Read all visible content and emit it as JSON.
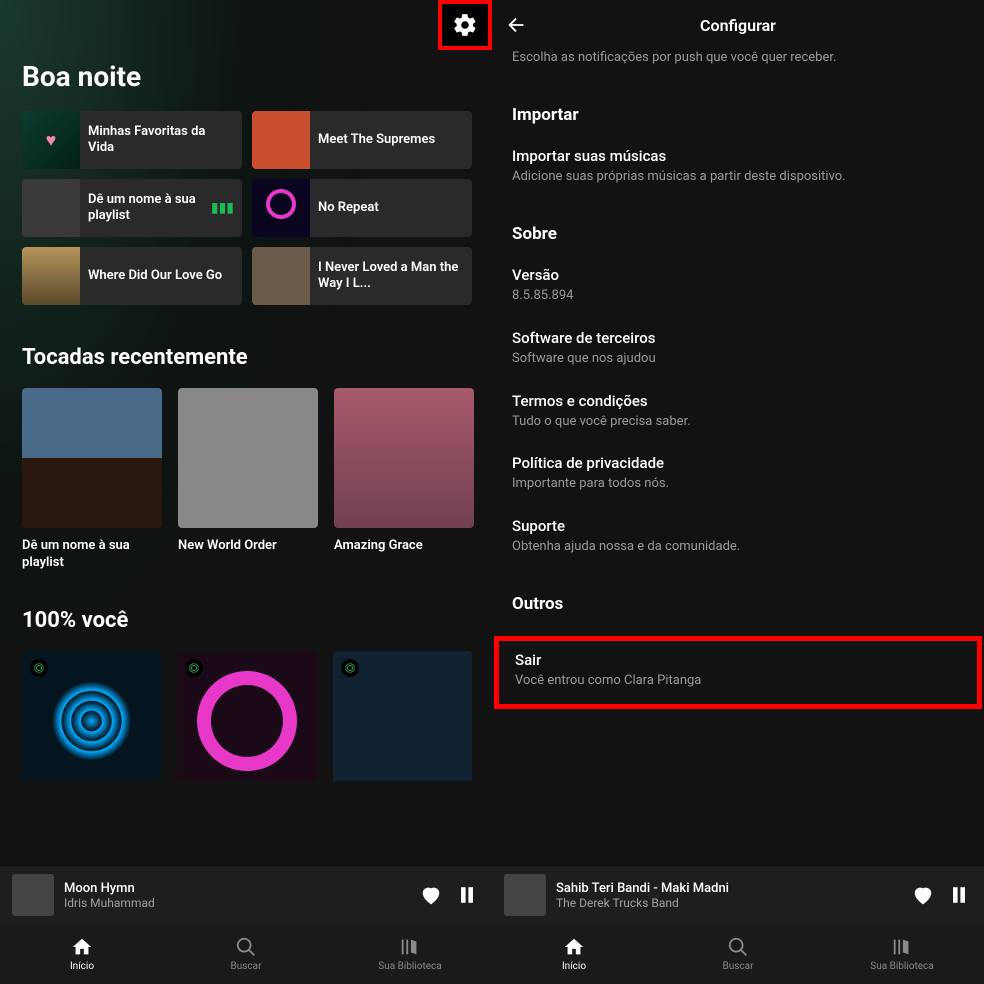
{
  "left": {
    "greeting": "Boa noite",
    "tiles": [
      {
        "label": "Minhas Favoritas da Vida"
      },
      {
        "label": "Meet The Supremes"
      },
      {
        "label": "Dê um nome à sua playlist",
        "playing": true
      },
      {
        "label": "No Repeat"
      },
      {
        "label": "Where Did Our Love Go"
      },
      {
        "label": "I Never Loved a Man the Way I L..."
      }
    ],
    "recent_title": "Tocadas recentemente",
    "recent": [
      {
        "label": "Dê um nome à sua playlist"
      },
      {
        "label": "New World Order"
      },
      {
        "label": "Amazing Grace"
      }
    ],
    "voce_title": "100% você",
    "nowplaying": {
      "title": "Moon Hymn",
      "artist": "Idris Muhammad"
    }
  },
  "right": {
    "header": "Configurar",
    "notif_sub": "Escolha as notificações por push que você quer receber.",
    "import_head": "Importar",
    "import": {
      "label": "Importar suas músicas",
      "sub": "Adicione suas próprias músicas a partir deste dispositivo."
    },
    "about_head": "Sobre",
    "version": {
      "label": "Versão",
      "value": "8.5.85.894"
    },
    "thirdparty": {
      "label": "Software de terceiros",
      "sub": "Software que nos ajudou"
    },
    "terms": {
      "label": "Termos e condições",
      "sub": "Tudo o que você precisa saber."
    },
    "privacy": {
      "label": "Política de privacidade",
      "sub": "Importante para todos nós."
    },
    "support": {
      "label": "Suporte",
      "sub": "Obtenha ajuda nossa e da comunidade."
    },
    "other_head": "Outros",
    "logout": {
      "label": "Sair",
      "sub": "Você entrou como Clara Pitanga"
    },
    "nowplaying": {
      "title": "Sahib Teri Bandi - Maki Madni",
      "artist": "The Derek Trucks Band"
    }
  },
  "nav": {
    "home": "Início",
    "search": "Buscar",
    "library": "Sua Biblioteca"
  }
}
